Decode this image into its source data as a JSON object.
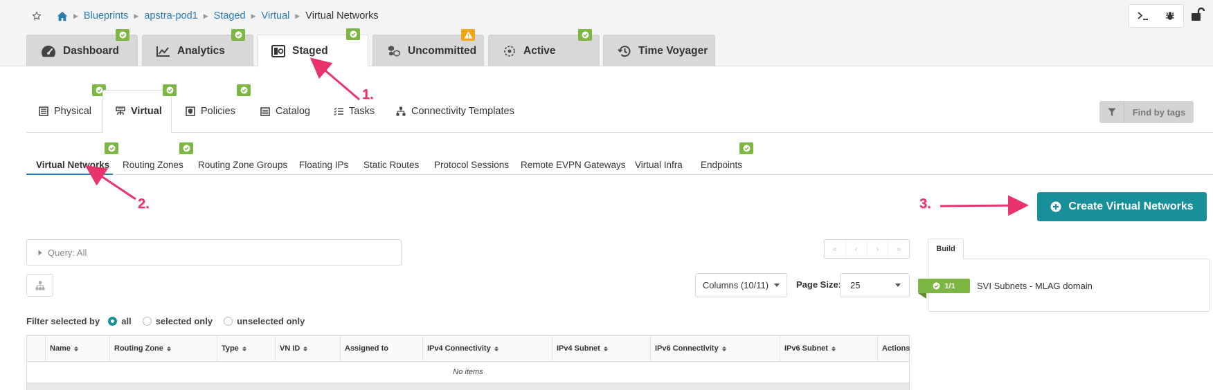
{
  "breadcrumb": {
    "items": [
      "Blueprints",
      "apstra-pod1",
      "Staged",
      "Virtual"
    ],
    "current": "Virtual Networks"
  },
  "main_tabs": [
    {
      "label": "Dashboard",
      "icon": "gauge-icon",
      "badge": "ok"
    },
    {
      "label": "Analytics",
      "icon": "chart-line-icon",
      "badge": "ok"
    },
    {
      "label": "Staged",
      "icon": "staged-icon",
      "badge": "ok",
      "active": true
    },
    {
      "label": "Uncommitted",
      "icon": "cubes-icon",
      "badge": "warning"
    },
    {
      "label": "Active",
      "icon": "active-icon",
      "badge": "ok"
    },
    {
      "label": "Time Voyager",
      "icon": "history-icon"
    }
  ],
  "secondary_tabs": [
    {
      "label": "Physical",
      "icon": "rack-icon",
      "badge": "ok"
    },
    {
      "label": "Virtual",
      "icon": "network-icon",
      "badge": "ok",
      "active": true
    },
    {
      "label": "Policies",
      "icon": "shield-icon",
      "badge": "ok"
    },
    {
      "label": "Catalog",
      "icon": "list-icon"
    },
    {
      "label": "Tasks",
      "icon": "tasks-icon"
    },
    {
      "label": "Connectivity Templates",
      "icon": "sitemap-icon"
    }
  ],
  "find_by_tags": "Find by tags",
  "sub_tabs": [
    {
      "label": "Virtual Networks",
      "active": true,
      "badge": "ok"
    },
    {
      "label": "Routing Zones",
      "badge": "ok"
    },
    {
      "label": "Routing Zone Groups"
    },
    {
      "label": "Floating IPs"
    },
    {
      "label": "Static Routes"
    },
    {
      "label": "Protocol Sessions"
    },
    {
      "label": "Remote EVPN Gateways"
    },
    {
      "label": "Virtual Infra"
    },
    {
      "label": "Endpoints",
      "badge": "ok"
    }
  ],
  "create_button": "Create Virtual Networks",
  "query": "Query: All",
  "columns_button": "Columns (10/11)",
  "page_size": {
    "label": "Page Size:",
    "value": "25"
  },
  "filter": {
    "label": "Filter selected by",
    "options": [
      "all",
      "selected only",
      "unselected only"
    ],
    "selected": "all"
  },
  "table": {
    "columns": [
      "Name",
      "Routing Zone",
      "Type",
      "VN ID",
      "Assigned to",
      "IPv4 Connectivity",
      "IPv4 Subnet",
      "IPv6 Connectivity",
      "IPv6 Subnet",
      "Actions"
    ],
    "empty_text": "No items"
  },
  "build": {
    "tab_label": "Build",
    "badge": "1/1",
    "item": "SVI Subnets - MLAG domain"
  },
  "annotations": [
    "1.",
    "2.",
    "3."
  ],
  "colors": {
    "accent": "#17909a",
    "link": "#2a7bb5",
    "ok_badge": "#7db743",
    "warn_badge": "#f2a71b",
    "annotation": "#e8336b"
  }
}
